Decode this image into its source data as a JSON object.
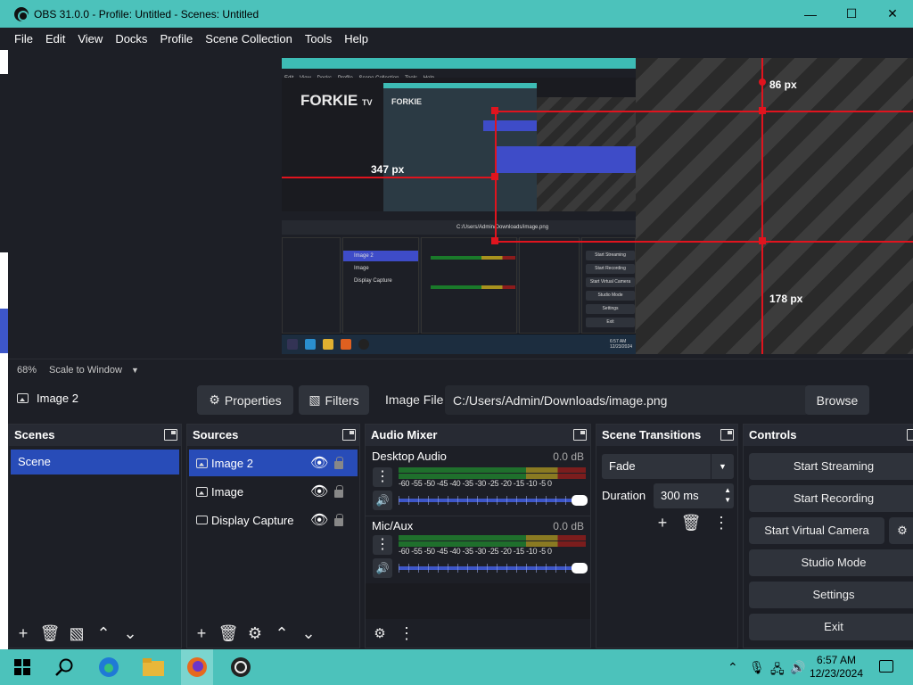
{
  "window": {
    "title": "OBS 31.0.0 - Profile: Untitled - Scenes: Untitled",
    "minimize": "—",
    "maximize": "☐",
    "close": "✕"
  },
  "menu": [
    "File",
    "Edit",
    "View",
    "Docks",
    "Profile",
    "Scene Collection",
    "Tools",
    "Help"
  ],
  "preview": {
    "brand": "FORKIE",
    "brand_sup": "TV",
    "measure_top": "86 px",
    "measure_left": "347 px",
    "measure_bottom": "178 px",
    "nested_menu": [
      "Edit",
      "View",
      "Docks",
      "Profile",
      "Scene Collection",
      "Tools",
      "Help"
    ],
    "nested_sources": [
      "Image 2",
      "Image",
      "Display Capture"
    ],
    "nested_controls": [
      "Start Streaming",
      "Start Recording",
      "Start Virtual Camera",
      "Studio Mode",
      "Settings",
      "Exit"
    ],
    "nested_file": "C:/Users/Admin/Downloads/image.png",
    "nested_clock": "6:57 AM\n12/23/2024"
  },
  "scale": {
    "zoom": "68%",
    "mode": "Scale to Window"
  },
  "toolbar": {
    "source_name": "Image 2",
    "properties": "Properties",
    "filters": "Filters",
    "image_file_label": "Image File",
    "path": "C:/Users/Admin/Downloads/image.png",
    "browse": "Browse"
  },
  "scenes": {
    "title": "Scenes",
    "items": [
      "Scene"
    ]
  },
  "sources": {
    "title": "Sources",
    "items": [
      "Image 2",
      "Image",
      "Display Capture"
    ]
  },
  "mixer": {
    "title": "Audio Mixer",
    "channels": [
      {
        "name": "Desktop Audio",
        "db": "0.0 dB"
      },
      {
        "name": "Mic/Aux",
        "db": "0.0 dB"
      }
    ],
    "scale": "-60 -55 -50 -45 -40 -35 -30 -25 -20 -15 -10 -5  0"
  },
  "transitions": {
    "title": "Scene Transitions",
    "type": "Fade",
    "duration_label": "Duration",
    "duration": "300 ms"
  },
  "controls": {
    "title": "Controls",
    "start_streaming": "Start Streaming",
    "start_recording": "Start Recording",
    "start_virtual_camera": "Start Virtual Camera",
    "studio_mode": "Studio Mode",
    "settings": "Settings",
    "exit": "Exit"
  },
  "taskbar": {
    "time": "6:57 AM",
    "date": "12/23/2024"
  },
  "colors": {
    "accent": "#4cc2bb",
    "selection": "#284cb8",
    "measure": "#e0141e"
  }
}
